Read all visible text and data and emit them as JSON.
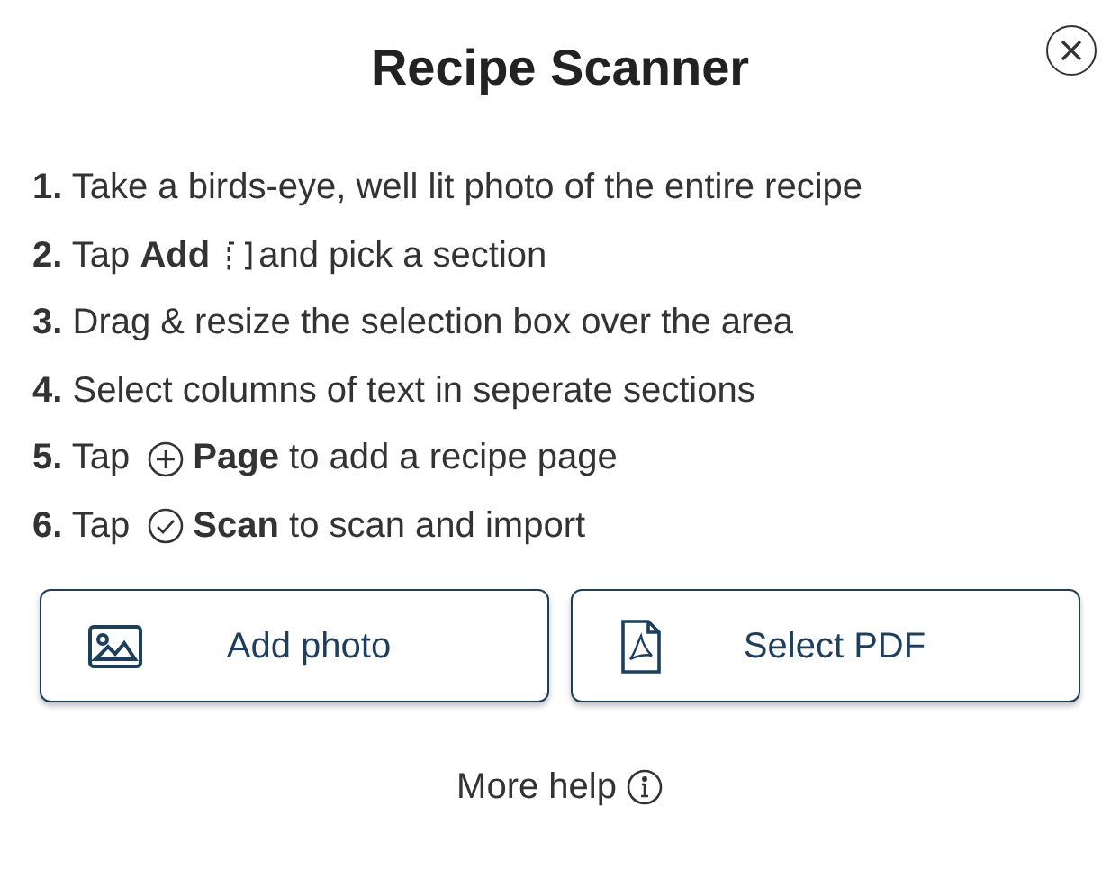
{
  "title": "Recipe Scanner",
  "steps": [
    {
      "parts": [
        {
          "kind": "text",
          "text": "**1.** Take a birds-eye, well lit photo of the entire recipe"
        }
      ]
    },
    {
      "parts": [
        {
          "kind": "text",
          "text": "**2.** Tap **Add**"
        },
        {
          "kind": "bracket"
        },
        {
          "kind": "text",
          "text": "and pick a section"
        }
      ]
    },
    {
      "parts": [
        {
          "kind": "text",
          "text": "**3.** Drag & resize the selection box over the area"
        }
      ]
    },
    {
      "parts": [
        {
          "kind": "text",
          "text": "**4.** Select columns of text in seperate sections"
        }
      ]
    },
    {
      "parts": [
        {
          "kind": "text",
          "text": "**5.** Tap"
        },
        {
          "kind": "plus"
        },
        {
          "kind": "text",
          "text": "**Page** to add a recipe page"
        }
      ]
    },
    {
      "parts": [
        {
          "kind": "text",
          "text": "**6.** Tap"
        },
        {
          "kind": "check"
        },
        {
          "kind": "text",
          "text": "**Scan** to scan and import"
        }
      ]
    }
  ],
  "buttons": [
    {
      "kind": "photo",
      "label": "Add photo"
    },
    {
      "kind": "pdf",
      "label": "Select PDF"
    }
  ],
  "help": "More help"
}
